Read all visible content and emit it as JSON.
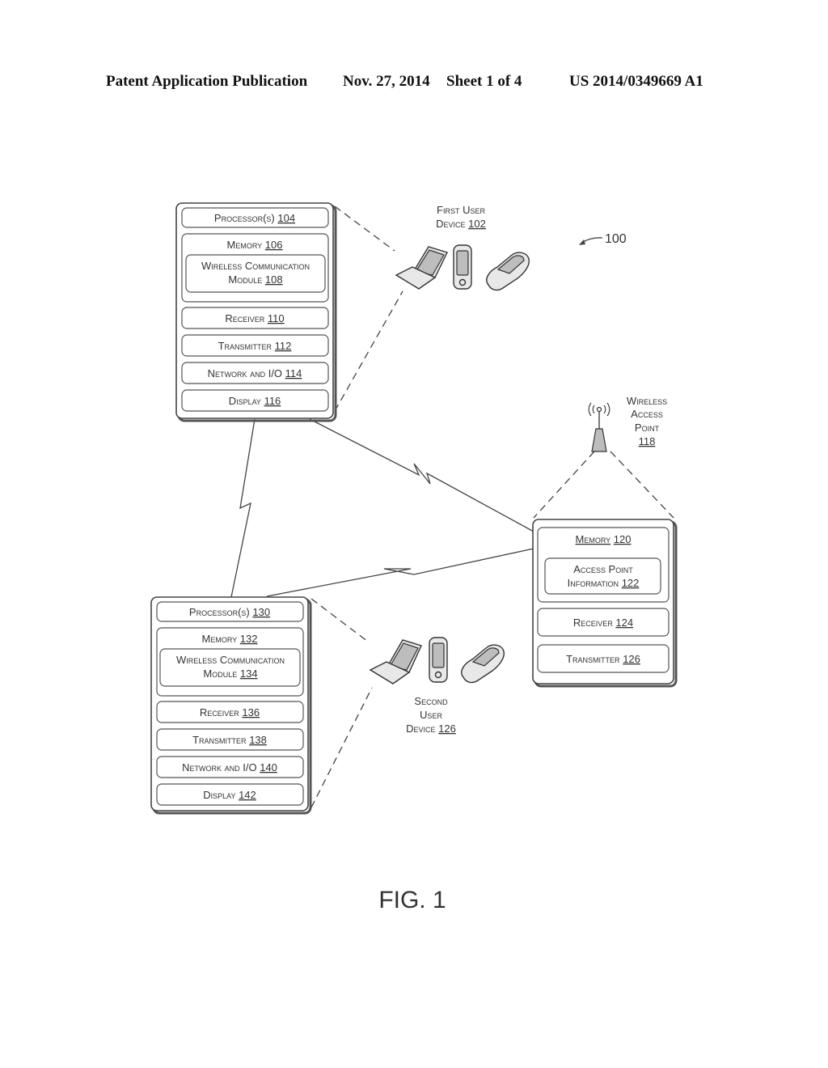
{
  "header": {
    "publication": "Patent Application Publication",
    "date": "Nov. 27, 2014",
    "sheet": "Sheet 1 of 4",
    "number": "US 2014/0349669 A1"
  },
  "figure": {
    "label": "FIG. 1",
    "system_ref": "100",
    "first_device_box": {
      "processor": {
        "text": "Processor(s)",
        "ref": "104"
      },
      "memory": {
        "text": "Memory",
        "ref": "106"
      },
      "module_line1": "Wireless Communication",
      "module_line2": {
        "text": "Module",
        "ref": "108"
      },
      "receiver": {
        "text": "Receiver",
        "ref": "110"
      },
      "transmitter": {
        "text": "Transmitter",
        "ref": "112"
      },
      "network": {
        "text": "Network and I/O",
        "ref": "114"
      },
      "display": {
        "text": "Display",
        "ref": "116"
      }
    },
    "first_user_device": {
      "line1": "First User",
      "line2": "Device",
      "ref": "102"
    },
    "access_point_label": {
      "line1": "Wireless",
      "line2": "Access",
      "line3": "Point",
      "ref": "118"
    },
    "access_point_box": {
      "memory": {
        "text": "Memory",
        "ref": "120"
      },
      "info_line1": "Access Point",
      "info_line2": {
        "text": "Information",
        "ref": "122"
      },
      "receiver": {
        "text": "Receiver",
        "ref": "124"
      },
      "transmitter": {
        "text": "Transmitter",
        "ref": "126"
      }
    },
    "second_device_box": {
      "processor": {
        "text": "Processor(s)",
        "ref": "130"
      },
      "memory": {
        "text": "Memory",
        "ref": "132"
      },
      "module_line1": "Wireless Communication",
      "module_line2": {
        "text": "Module",
        "ref": "134"
      },
      "receiver": {
        "text": "Receiver",
        "ref": "136"
      },
      "transmitter": {
        "text": "Transmitter",
        "ref": "138"
      },
      "network": {
        "text": "Network and I/O",
        "ref": "140"
      },
      "display": {
        "text": "Display",
        "ref": "142"
      }
    },
    "second_user_device": {
      "line1": "Second",
      "line2": "User",
      "line3": "Device",
      "ref": "126"
    }
  }
}
